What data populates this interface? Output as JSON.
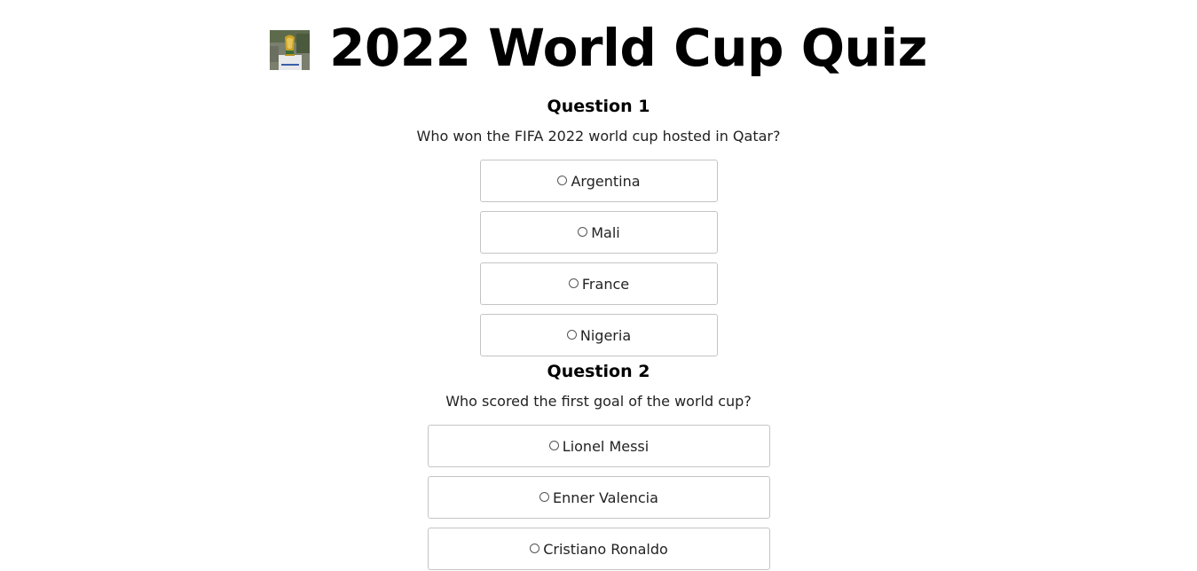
{
  "header": {
    "logo_icon": "world-cup-trophy-image",
    "title": "2022 World Cup Quiz"
  },
  "questions": [
    {
      "heading": "Question 1",
      "text": "Who won the FIFA 2022 world cup hosted in Qatar?",
      "options": [
        "Argentina",
        "Mali",
        "France",
        "Nigeria"
      ]
    },
    {
      "heading": "Question 2",
      "text": "Who scored the first goal of the world cup?",
      "options": [
        "Lionel Messi",
        "Enner Valencia",
        "Cristiano Ronaldo"
      ]
    }
  ]
}
